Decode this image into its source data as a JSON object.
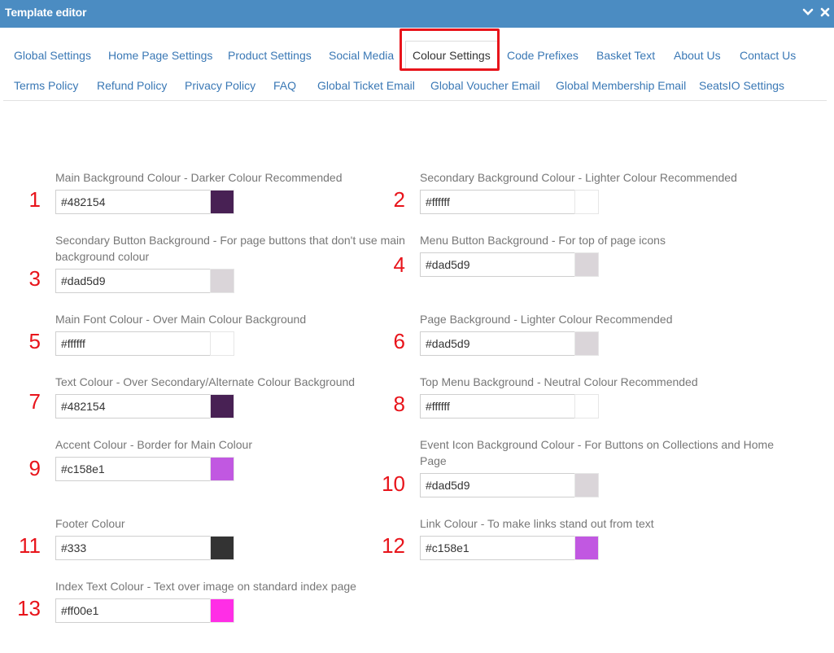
{
  "window": {
    "title": "Template editor"
  },
  "tabs_row1": [
    {
      "label": "Global Settings"
    },
    {
      "label": "Home Page Settings"
    },
    {
      "label": "Product Settings"
    },
    {
      "label": "Social Media"
    },
    {
      "label": "Colour Settings",
      "active": true
    },
    {
      "label": "Code Prefixes"
    },
    {
      "label": "Basket Text"
    },
    {
      "label": "About Us"
    },
    {
      "label": "Contact Us"
    }
  ],
  "tabs_row2": [
    {
      "label": "Terms Policy"
    },
    {
      "label": "Refund Policy"
    },
    {
      "label": "Privacy Policy"
    },
    {
      "label": "FAQ"
    },
    {
      "label": "Global Ticket Email"
    },
    {
      "label": "Global Voucher Email"
    },
    {
      "label": "Global Membership Email"
    },
    {
      "label": "SeatsIO Settings"
    }
  ],
  "colour_fields": [
    {
      "num": "1",
      "label": "Main Background Colour - Darker Colour Recommended",
      "value": "#482154",
      "swatch": "#482154"
    },
    {
      "num": "2",
      "label": "Secondary Background Colour - Lighter Colour Recommended",
      "value": "#ffffff",
      "swatch": "#ffffff"
    },
    {
      "num": "3",
      "label": "Secondary Button Background - For page buttons that don't use main background colour",
      "value": "#dad5d9",
      "swatch": "#dad5d9"
    },
    {
      "num": "4",
      "label": "Menu Button Background - For top of page icons",
      "value": "#dad5d9",
      "swatch": "#dad5d9"
    },
    {
      "num": "5",
      "label": "Main Font Colour - Over Main Colour Background",
      "value": "#ffffff",
      "swatch": "#ffffff"
    },
    {
      "num": "6",
      "label": "Page Background - Lighter Colour Recommended",
      "value": "#dad5d9",
      "swatch": "#dad5d9"
    },
    {
      "num": "7",
      "label": "Text Colour - Over Secondary/Alternate Colour Background",
      "value": "#482154",
      "swatch": "#482154"
    },
    {
      "num": "8",
      "label": "Top Menu Background - Neutral Colour Recommended",
      "value": "#ffffff",
      "swatch": "#ffffff"
    },
    {
      "num": "9",
      "label": "Accent Colour - Border for Main Colour",
      "value": "#c158e1",
      "swatch": "#c158e1"
    },
    {
      "num": "10",
      "label": "Event Icon Background Colour - For Buttons on Collections and Home Page",
      "value": "#dad5d9",
      "swatch": "#dad5d9"
    },
    {
      "num": "11",
      "label": "Footer Colour",
      "value": "#333",
      "swatch": "#333333"
    },
    {
      "num": "12",
      "label": "Link Colour - To make links stand out from text",
      "value": "#c158e1",
      "swatch": "#c158e1"
    },
    {
      "num": "13",
      "label": "Index Text Colour - Text over image on standard index page",
      "value": "#ff00e1",
      "swatch": "#ff2ee6"
    }
  ],
  "colors": {
    "titlebar": "#4b8cc2",
    "tab_link": "#3a78b5",
    "highlight": "#e8141b"
  }
}
